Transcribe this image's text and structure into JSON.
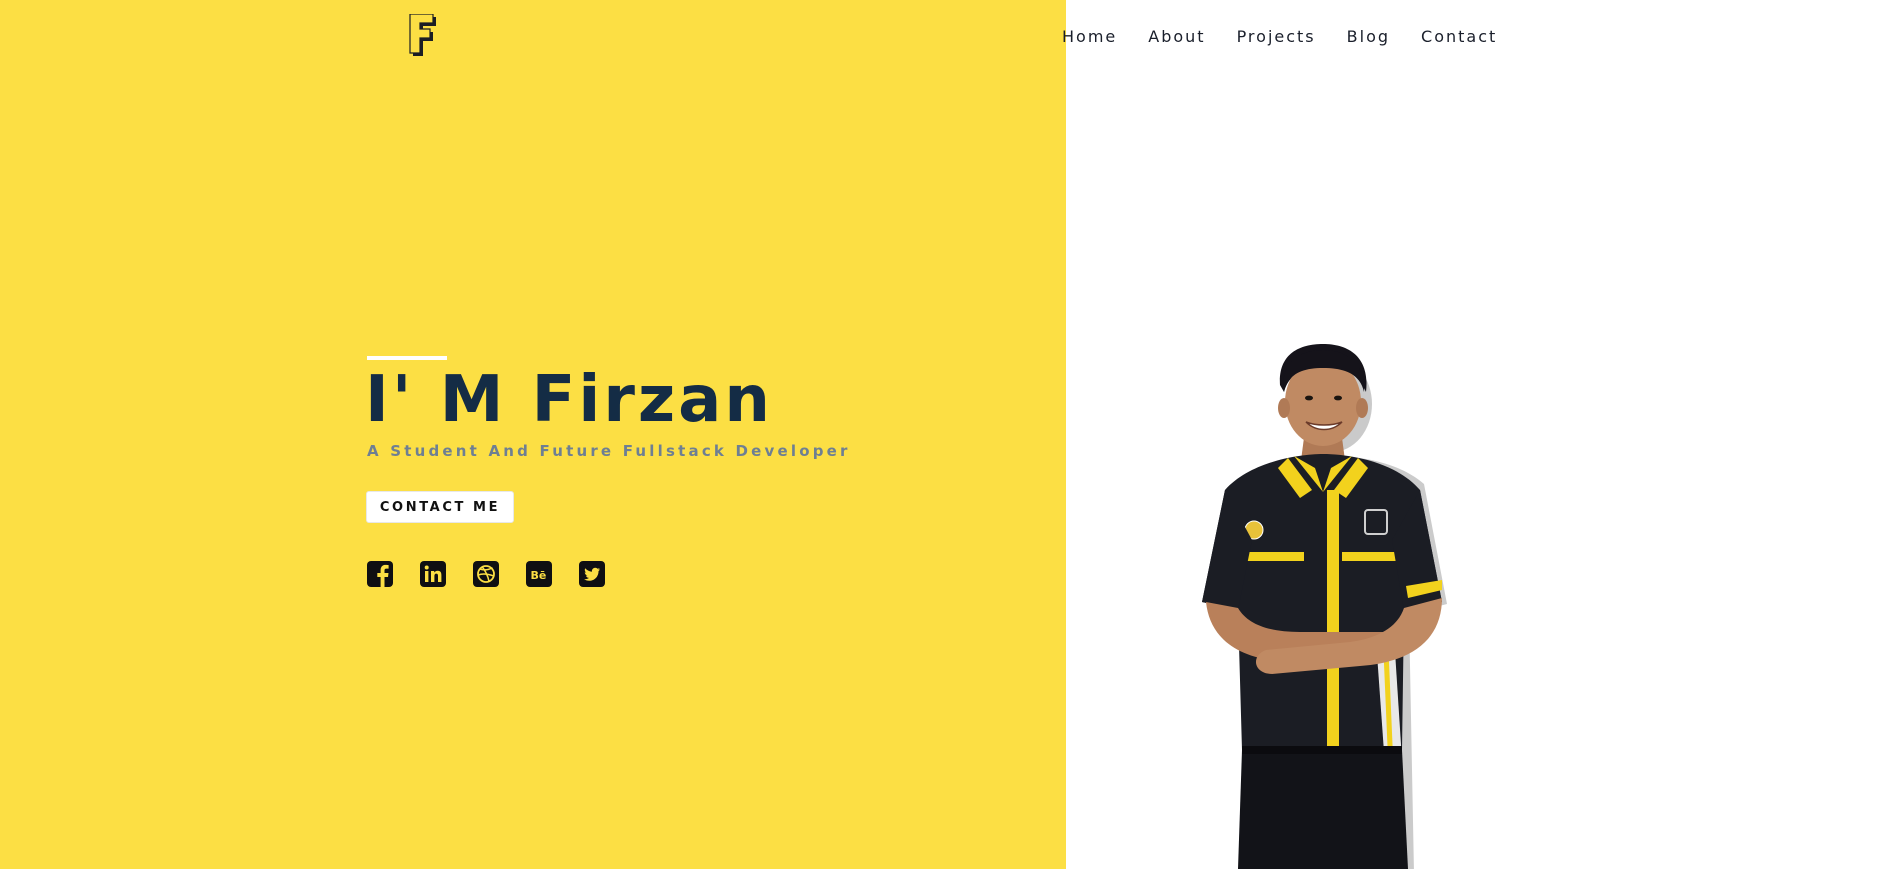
{
  "logo": {
    "letter": "F",
    "icon": "f-logo-icon"
  },
  "nav": {
    "items": [
      {
        "label": "Home"
      },
      {
        "label": "About"
      },
      {
        "label": "Projects"
      },
      {
        "label": "Blog"
      },
      {
        "label": "Contact"
      }
    ]
  },
  "hero": {
    "title": "I' M Firzan",
    "subtitle": "A Student And Future Fullstack Developer",
    "contact_button": "CONTACT ME"
  },
  "socials": [
    {
      "icon": "facebook-icon"
    },
    {
      "icon": "linkedin-icon"
    },
    {
      "icon": "dribbble-icon"
    },
    {
      "icon": "behance-icon"
    },
    {
      "icon": "twitter-icon"
    }
  ],
  "photo": {
    "icon": "profile-photo"
  },
  "colors": {
    "accent_yellow": "#fcdf44",
    "title_navy": "#142c45",
    "subtitle_gray": "#6e7f93",
    "nav_text": "#1a1f2b",
    "shirt_black": "#1b1d24",
    "stripe_yellow": "#f2d21d"
  }
}
